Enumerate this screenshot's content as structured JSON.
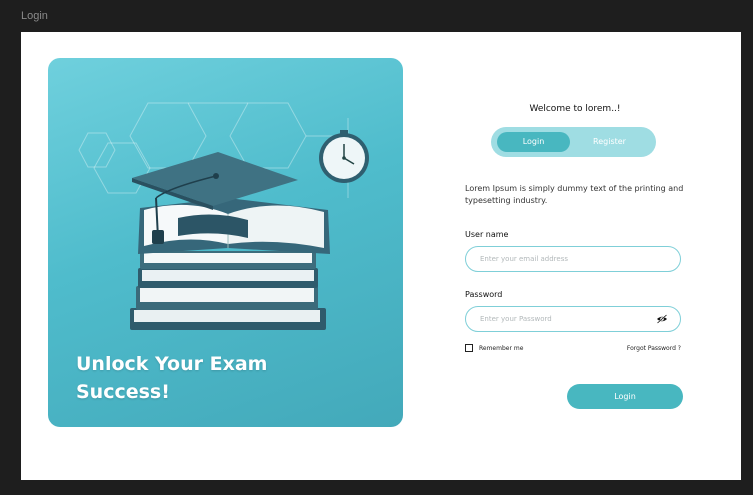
{
  "frame": {
    "label": "Login"
  },
  "hero": {
    "title_line1": "Unlock Your Exam",
    "title_line2": "Success!"
  },
  "form": {
    "welcome": "Welcome to lorem..!",
    "tabs": [
      {
        "label": "Login",
        "active": true
      },
      {
        "label": "Register",
        "active": false
      }
    ],
    "description": "Lorem Ipsum is simply dummy text of the printing and typesetting industry.",
    "username": {
      "label": "User name",
      "placeholder": "Enter your email address",
      "value": ""
    },
    "password": {
      "label": "Password",
      "placeholder": "Enter your Password",
      "value": ""
    },
    "remember_label": "Remember me",
    "remember_checked": false,
    "forgot_label": "Forgot Password ?",
    "submit_label": "Login"
  },
  "icons": {
    "password_toggle": "eye-slash-icon"
  },
  "colors": {
    "accent": "#48b7c0",
    "accent_light": "#9fdde3",
    "hero_bg": "#4fbccc",
    "frame_bg": "#1e1e1e"
  }
}
